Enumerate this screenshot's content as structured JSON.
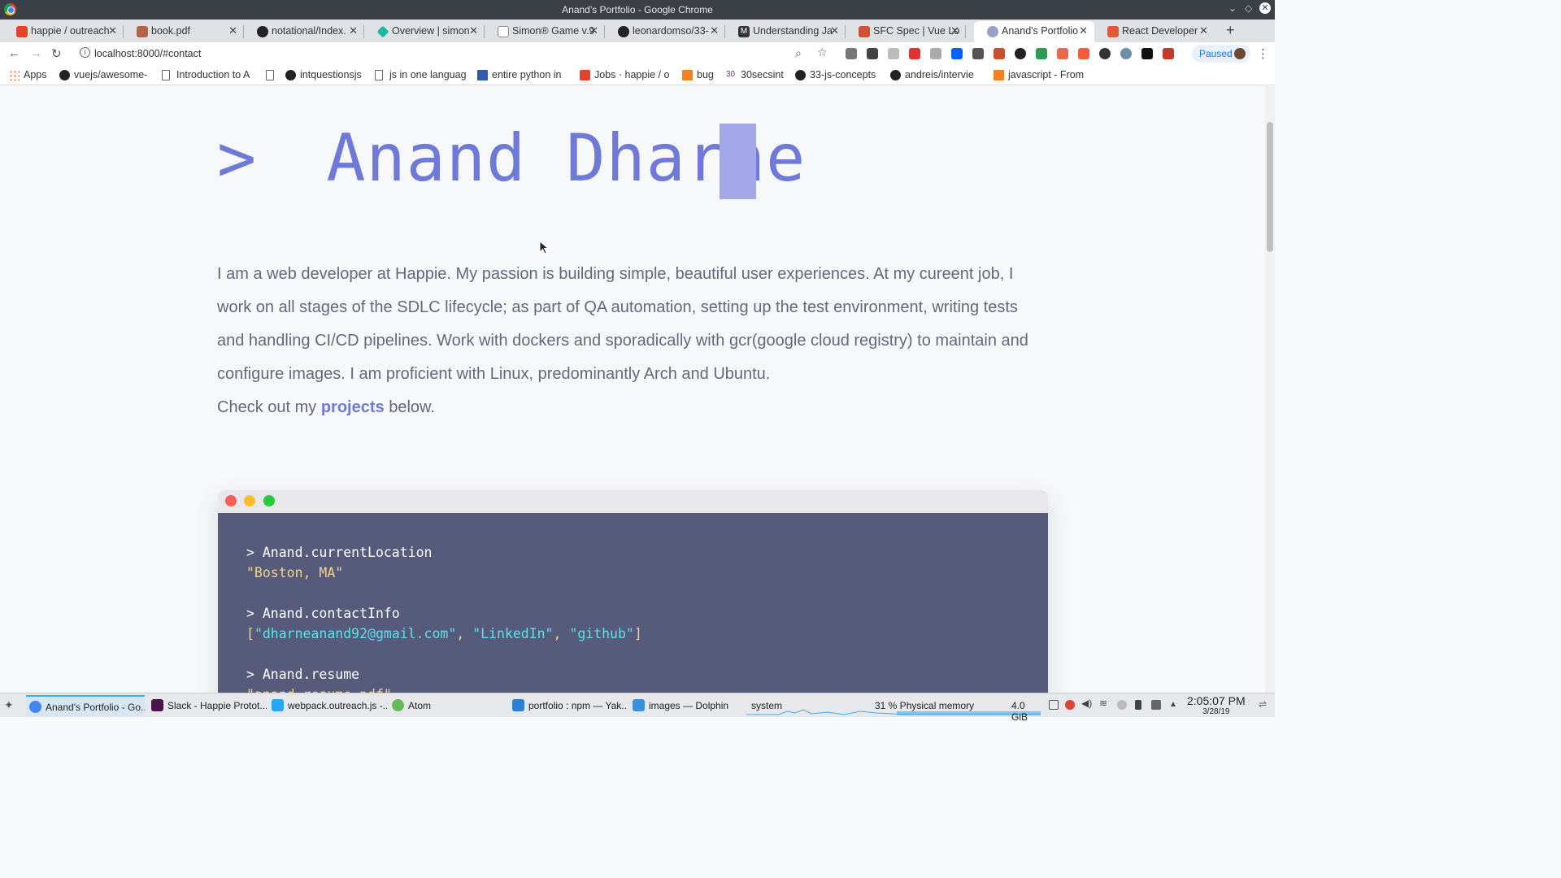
{
  "window": {
    "title": "Anand's Portfolio - Google Chrome"
  },
  "tabs": [
    {
      "label": "happie / outreach",
      "color": "#e24329"
    },
    {
      "label": "book.pdf",
      "color": "#b0644b"
    },
    {
      "label": "notational/Index.",
      "color": "#222222"
    },
    {
      "label": "Overview | simon",
      "color": "#1fb5a3"
    },
    {
      "label": "Simon® Game v.9",
      "color": "#888888"
    },
    {
      "label": "leonardomso/33-",
      "color": "#222222"
    },
    {
      "label": "Understanding Ja",
      "color": "#333333"
    },
    {
      "label": "SFC Spec | Vue Lo",
      "color": "#d0503a"
    },
    {
      "label": "Anand's Portfolio",
      "color": "#9aa0c8"
    },
    {
      "label": "React Developer",
      "color": "#e05a3a"
    }
  ],
  "toolbar": {
    "url": "localhost:8000/#contact",
    "paused_label": "Paused"
  },
  "bookmarks": [
    {
      "label": "Apps",
      "icon": "apps"
    },
    {
      "label": "vuejs/awesome-",
      "icon": "github"
    },
    {
      "label": "Introduction to A",
      "icon": "doc"
    },
    {
      "label": "",
      "icon": "doc"
    },
    {
      "label": "intquestionsjs",
      "icon": "github"
    },
    {
      "label": "js in one languag",
      "icon": "doc"
    },
    {
      "label": "entire python in",
      "icon": "b"
    },
    {
      "label": "Jobs · happie / o",
      "icon": "fox"
    },
    {
      "label": "bug",
      "icon": "so"
    },
    {
      "label": "30secsint",
      "icon": "num"
    },
    {
      "label": "33-js-concepts",
      "icon": "github"
    },
    {
      "label": "andreis/intervie",
      "icon": "github"
    },
    {
      "label": "javascript - From",
      "icon": "so"
    }
  ],
  "page": {
    "hero_prompt": ">",
    "hero_name": "Anand Dharne",
    "bio": "I am a web developer at Happie. My passion is building simple, beautiful user experiences. At my cureent job, I work on all stages of the SDLC lifecycle; as part of QA automation, setting up the test environment, writing tests and handling CI/CD pipelines. Work with dockers and sporadically with gcr(google cloud registry) to maintain and configure images. I am proficient with Linux, predominantly Arch and Ubuntu.",
    "cta_before": "Check out my ",
    "cta_link": "projects",
    "cta_after": " below.",
    "terminal": {
      "cmd1": "> Anand.currentLocation",
      "out1": "\"Boston, MA\"",
      "cmd2": "> Anand.contactInfo",
      "out2_open": "[",
      "out2_email": "\"dharneanand92@gmail.com\"",
      "out2_sep1": ", ",
      "out2_linkedin": "\"LinkedIn\"",
      "out2_sep2": ", ",
      "out2_github": "\"github\"",
      "out2_close": "]",
      "cmd3": "> Anand.resume",
      "out3": "\"anand_resume.pdf\""
    }
  },
  "taskbar": {
    "tasks": [
      {
        "label": "Anand's Portfolio - Go...",
        "color": "#4285f4"
      },
      {
        "label": "Slack - Happie Protot...",
        "color": "#4a154b"
      },
      {
        "label": "webpack.outreach.js -...",
        "color": "#23a9f2"
      },
      {
        "label": "Atom",
        "color": "#66b85a"
      },
      {
        "label": "portfolio : npm — Yak...",
        "color": "#2c7fd1"
      },
      {
        "label": "images — Dolphin",
        "color": "#3d8fd9"
      }
    ],
    "monitor_label": "system",
    "memory_label": "31 % Physical memory",
    "memory_value": "4.0 GiB",
    "time": "2:05:07 PM",
    "date": "3/28/19"
  }
}
